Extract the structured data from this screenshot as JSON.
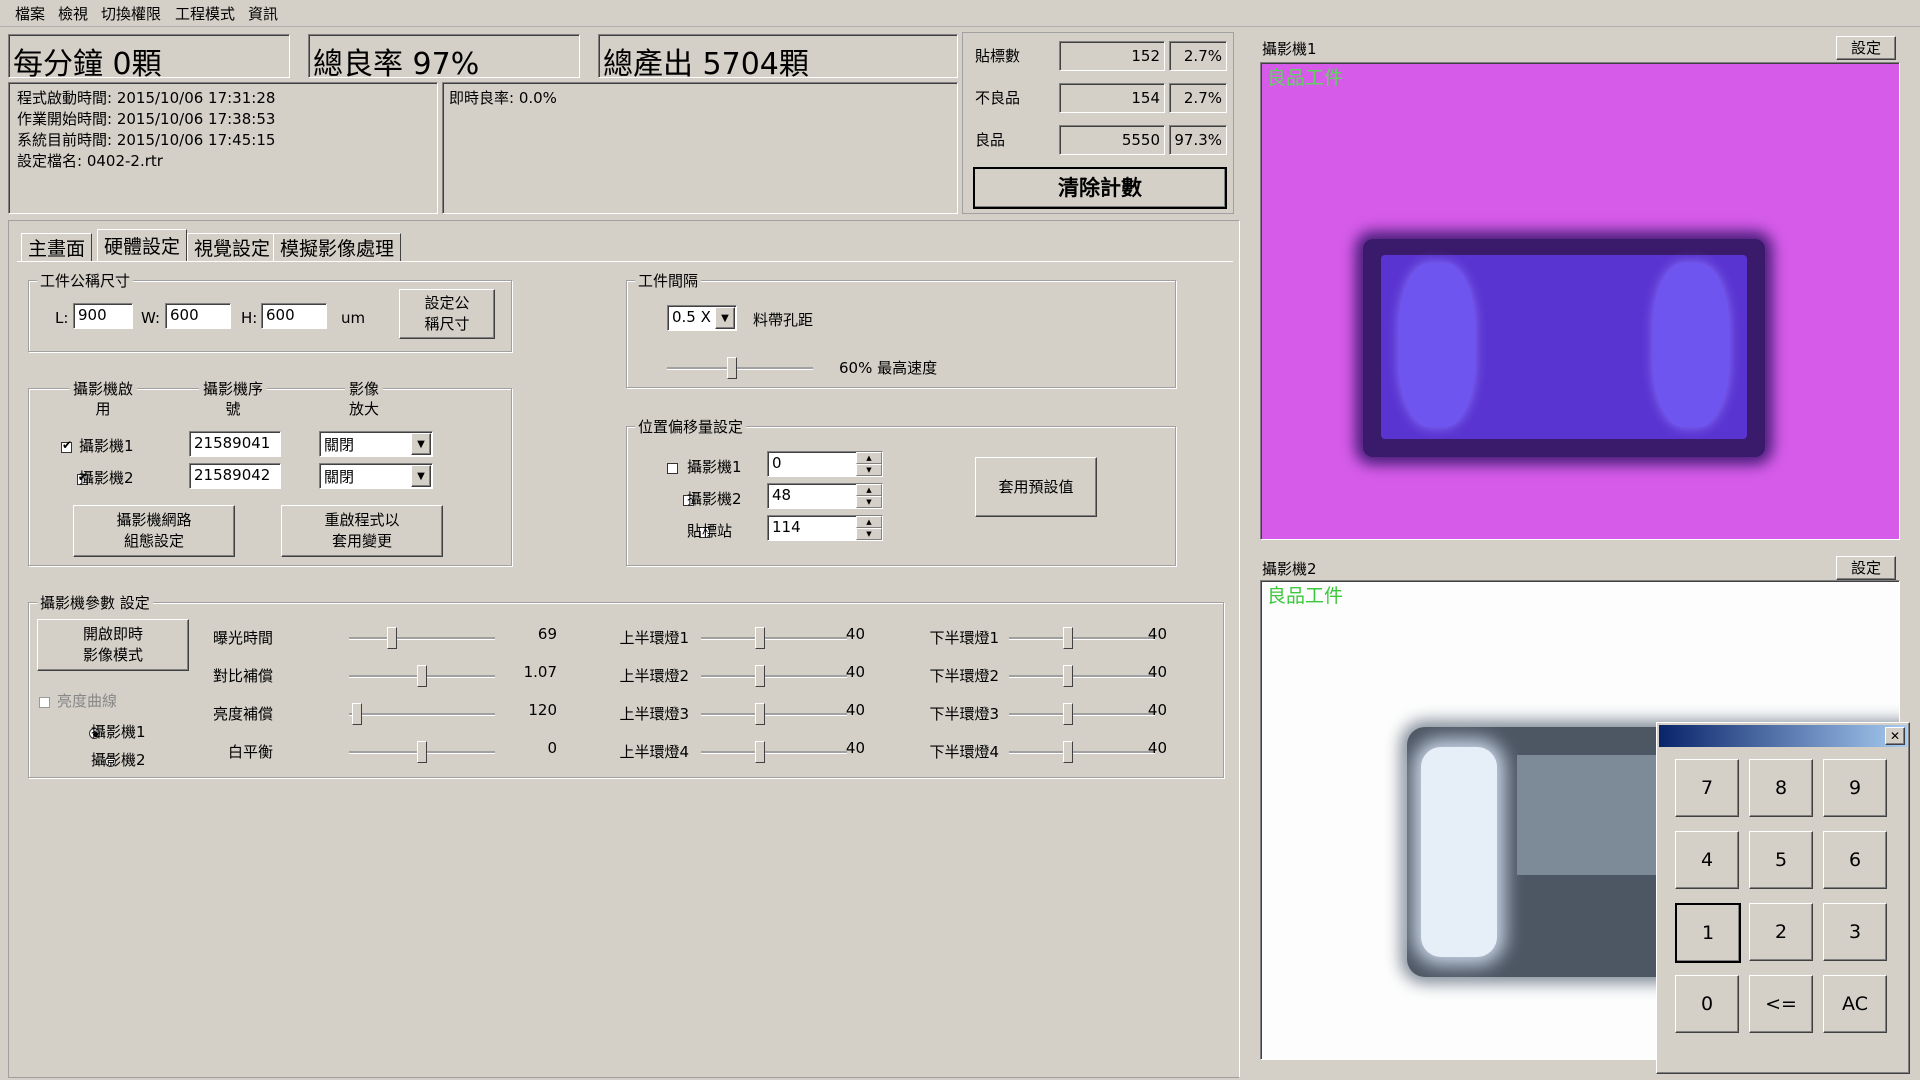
{
  "menu": [
    "檔案",
    "檢視",
    "切換權限",
    "工程模式",
    "資訊"
  ],
  "header": {
    "per_minute": "每分鐘 0顆",
    "yield": "總良率 97%",
    "total": "總產出 5704顆"
  },
  "info": {
    "lines": [
      "程式啟動時間: 2015/10/06 17:31:28",
      "作業開始時間: 2015/10/06 17:38:53",
      "系統目前時間: 2015/10/06 17:45:15",
      "設定檔名: 0402-2.rtr"
    ],
    "realtime_yield": "即時良率: 0.0%"
  },
  "stats": [
    {
      "label": "貼標數",
      "count": "152",
      "pct": "2.7%"
    },
    {
      "label": "不良品",
      "count": "154",
      "pct": "2.7%"
    },
    {
      "label": "良品",
      "count": "5550",
      "pct": "97.3%"
    }
  ],
  "clear_button": "清除計數",
  "tabs": [
    "主畫面",
    "硬體設定",
    "視覺設定",
    "模擬影像處理"
  ],
  "nominal": {
    "title": "工件公稱尺寸",
    "l_label": "L:",
    "l": "900",
    "w_label": "W:",
    "w": "600",
    "h_label": "H:",
    "h": "600",
    "unit": "um",
    "set_button": "設定公\n稱尺寸"
  },
  "camera_table": {
    "col1": "攝影機啟\n用",
    "col2": "攝影機序\n號",
    "col3": "影像\n放大",
    "rows": [
      {
        "name": "攝影機1",
        "serial": "21589041",
        "zoom": "關閉"
      },
      {
        "name": "攝影機2",
        "serial": "21589042",
        "zoom": "關閉"
      }
    ],
    "network_button": "攝影機網路\n組態設定",
    "restart_button": "重啟程式以\n套用變更"
  },
  "spacing": {
    "title": "工件間隔",
    "pitch": "0.5 X",
    "pitch_label": "料帶孔距",
    "speed_label": "60% 最高速度",
    "speed_pct": 60
  },
  "offset": {
    "title": "位置偏移量設定",
    "rows": [
      {
        "name": "攝影機1",
        "value": "0"
      },
      {
        "name": "攝影機2",
        "value": "48"
      },
      {
        "name": "貼標站",
        "value": "114"
      }
    ],
    "default_button": "套用預設值"
  },
  "params": {
    "title": "攝影機參數 設定",
    "live_button": "開啟即時\n影像模式",
    "curve_label": "亮度曲線",
    "radio1": "攝影機1",
    "radio2": "攝影機2",
    "sliders": [
      {
        "label": "曝光時間",
        "value": "69",
        "pos": 0.28
      },
      {
        "label": "對比補償",
        "value": "1.07",
        "pos": 0.5
      },
      {
        "label": "亮度補償",
        "value": "120",
        "pos": 0.02
      },
      {
        "label": "白平衡",
        "value": "0",
        "pos": 0.5
      }
    ],
    "upper": [
      {
        "label": "上半環燈1",
        "value": "40",
        "pos": 0.4
      },
      {
        "label": "上半環燈2",
        "value": "40",
        "pos": 0.4
      },
      {
        "label": "上半環燈3",
        "value": "40",
        "pos": 0.4
      },
      {
        "label": "上半環燈4",
        "value": "40",
        "pos": 0.4
      }
    ],
    "lower": [
      {
        "label": "下半環燈1",
        "value": "40",
        "pos": 0.4
      },
      {
        "label": "下半環燈2",
        "value": "40",
        "pos": 0.4
      },
      {
        "label": "下半環燈3",
        "value": "40",
        "pos": 0.4
      },
      {
        "label": "下半環燈4",
        "value": "40",
        "pos": 0.4
      }
    ]
  },
  "cam1": {
    "title": "攝影機1",
    "settings": "設定",
    "overlay": "良品工件"
  },
  "cam2": {
    "title": "攝影機2",
    "settings": "設定",
    "overlay": "良品工件"
  },
  "keypad": {
    "close": "✕",
    "keys": [
      "7",
      "8",
      "9",
      "4",
      "5",
      "6",
      "1",
      "2",
      "3",
      "0",
      "<=",
      "AC"
    ]
  }
}
